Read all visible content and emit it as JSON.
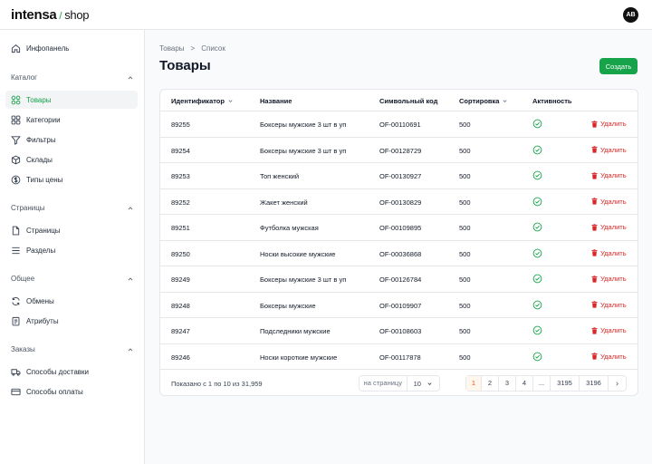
{
  "brand": {
    "name": "intensa",
    "slash": "/",
    "sub": "shop"
  },
  "user": {
    "initials": "AB"
  },
  "sidebar": {
    "dashboard": "Инфопанель",
    "groups": {
      "catalog": "Каталог",
      "pages": "Страницы",
      "general": "Общее",
      "orders": "Заказы"
    },
    "items": {
      "products": "Товары",
      "categories": "Категории",
      "filters": "Фильтры",
      "warehouses": "Склады",
      "price_types": "Типы цены",
      "pages": "Страницы",
      "sections": "Разделы",
      "exchanges": "Обмены",
      "attributes": "Атрибуты",
      "delivery": "Способы доставки",
      "payment": "Способы оплаты"
    }
  },
  "breadcrumb": {
    "first": "Товары",
    "sep": ">",
    "second": "Список"
  },
  "page": {
    "title": "Товары",
    "create_label": "Создать"
  },
  "table": {
    "columns": {
      "id": "Идентификатор",
      "name": "Название",
      "code": "Символьный код",
      "sort": "Сортировка",
      "active": "Активность"
    },
    "delete_label": "Удалить",
    "rows": [
      {
        "id": "89255",
        "name": "Боксеры мужские 3 шт в уп",
        "code": "OF-00110691",
        "sort": "500"
      },
      {
        "id": "89254",
        "name": "Боксеры мужские 3 шт в уп",
        "code": "OF-00128729",
        "sort": "500"
      },
      {
        "id": "89253",
        "name": "Топ женский",
        "code": "OF-00130927",
        "sort": "500"
      },
      {
        "id": "89252",
        "name": "Жакет женский",
        "code": "OF-00130829",
        "sort": "500"
      },
      {
        "id": "89251",
        "name": "Футболка мужская",
        "code": "OF-00109895",
        "sort": "500"
      },
      {
        "id": "89250",
        "name": "Носки высокие мужские",
        "code": "OF-00036868",
        "sort": "500"
      },
      {
        "id": "89249",
        "name": "Боксеры мужские 3 шт в уп",
        "code": "OF-00126784",
        "sort": "500"
      },
      {
        "id": "89248",
        "name": "Боксеры мужские",
        "code": "OF-00109907",
        "sort": "500"
      },
      {
        "id": "89247",
        "name": "Подследники мужские",
        "code": "OF-00108603",
        "sort": "500"
      },
      {
        "id": "89246",
        "name": "Носки короткие мужские",
        "code": "OF-00117878",
        "sort": "500"
      }
    ]
  },
  "footer": {
    "showing": "Показано с 1 по 10 из 31,959",
    "per_page_label": "на страницу",
    "per_page_value": "10",
    "pages": [
      "1",
      "2",
      "3",
      "4",
      "...",
      "3195",
      "3196"
    ],
    "current_page": "1"
  },
  "colors": {
    "accent": "#16a34a",
    "danger": "#dc2626",
    "active_page": "#ea580c"
  }
}
